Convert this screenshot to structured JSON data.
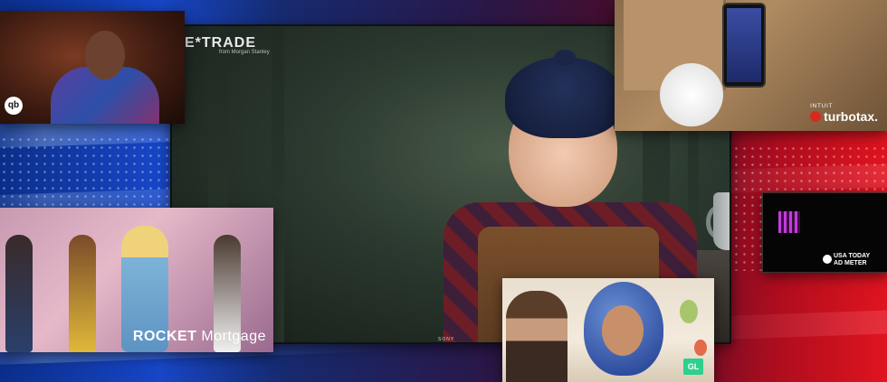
{
  "panels": {
    "main": {
      "brand": "E*TRADE",
      "brand_sub": "from Morgan Stanley",
      "tv_brand": "SONY"
    },
    "top_left": {
      "brand_icon": "qb"
    },
    "top_right": {
      "brand": "turbotax.",
      "brand_sub": "INTUIT"
    },
    "right": {
      "brand_line1": "USA TODAY",
      "brand_line2": "AD METER"
    },
    "left": {
      "brand_bold": "ROCKET",
      "brand_rest": " Mortgage"
    },
    "bottom": {
      "brand": "GL"
    }
  },
  "colors": {
    "left_accent": "#1746c7",
    "right_accent": "#e0141f"
  }
}
